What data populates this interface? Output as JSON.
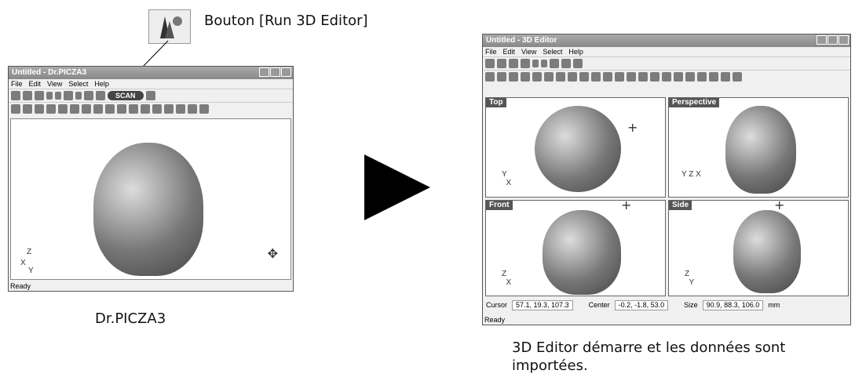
{
  "callout": {
    "label": "Bouton [Run 3D Editor]"
  },
  "left_window": {
    "title": "Untitled - Dr.PICZA3",
    "menu": [
      "File",
      "Edit",
      "View",
      "Select",
      "Help"
    ],
    "scan_label": "SCAN",
    "axis_z": "Z",
    "axis_x": "X",
    "axis_y": "Y",
    "status": "Ready",
    "caption": "Dr.PICZA3"
  },
  "right_window": {
    "title": "Untitled - 3D Editor",
    "menu": [
      "File",
      "Edit",
      "View",
      "Select",
      "Help"
    ],
    "views": {
      "top": "Top",
      "perspective": "Perspective",
      "front": "Front",
      "side": "Side"
    },
    "cursor_label": "Cursor",
    "cursor_value": "57.1, 19.3, 107.3",
    "center_label": "Center",
    "center_value": "-0.2, -1.8, 53.0",
    "size_label": "Size",
    "size_value": "90.9, 88.3, 106.0",
    "size_unit": "mm",
    "status": "Ready",
    "caption_line1": "3D Editor démarre et les données sont",
    "caption_line2": "importées."
  },
  "icons": [
    "run-3d-editor-icon",
    "play-arrow-icon",
    "crosshair-icon"
  ]
}
